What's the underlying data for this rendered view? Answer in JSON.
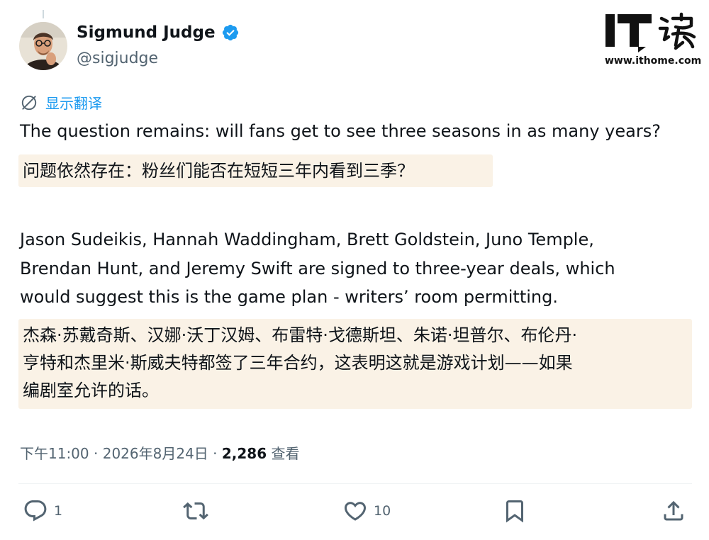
{
  "author": {
    "display_name": "Sigmund Judge",
    "handle": "@sigjudge"
  },
  "watermark": {
    "url": "www.ithome.com"
  },
  "translate_label": "显示翻译",
  "post": {
    "paragraph1_lines": [
      "The question remains: will fans get to see three seasons in as many years?"
    ],
    "paragraph1_translation_lines": [
      "问题依然存在：粉丝们能否在短短三年内看到三季？"
    ],
    "paragraph2_lines": [
      "Jason Sudeikis, Hannah Waddingham, Brett Goldstein, Juno Temple,",
      "Brendan Hunt, and Jeremy Swift are signed to three-year deals, which",
      "would suggest this is the game plan - writers’ room permitting."
    ],
    "paragraph2_translation_lines": [
      "杰森·苏戴奇斯、汉娜·沃丁汉姆、布雷特·戈德斯坦、朱诺·坦普尔、布伦丹·",
      "亨特和杰里米·斯威夫特都签了三年合约，这表明这就是游戏计划——如果",
      "编剧室允许的话。"
    ]
  },
  "meta": {
    "time": "下午11:00",
    "separator": " · ",
    "date": "2026年8月24日",
    "views_count": "2,286",
    "views_label": "查看"
  },
  "actions": {
    "reply_icon": "reply-icon",
    "reply_count": "1",
    "repost_icon": "repost-icon",
    "like_icon": "heart-icon",
    "like_count": "10",
    "bookmark_icon": "bookmark-icon",
    "share_icon": "share-icon"
  },
  "colors": {
    "accent": "#1d9bf0",
    "translation_bg": "#faf2e6",
    "secondary_text": "#536471",
    "primary_text": "#0f1419"
  }
}
